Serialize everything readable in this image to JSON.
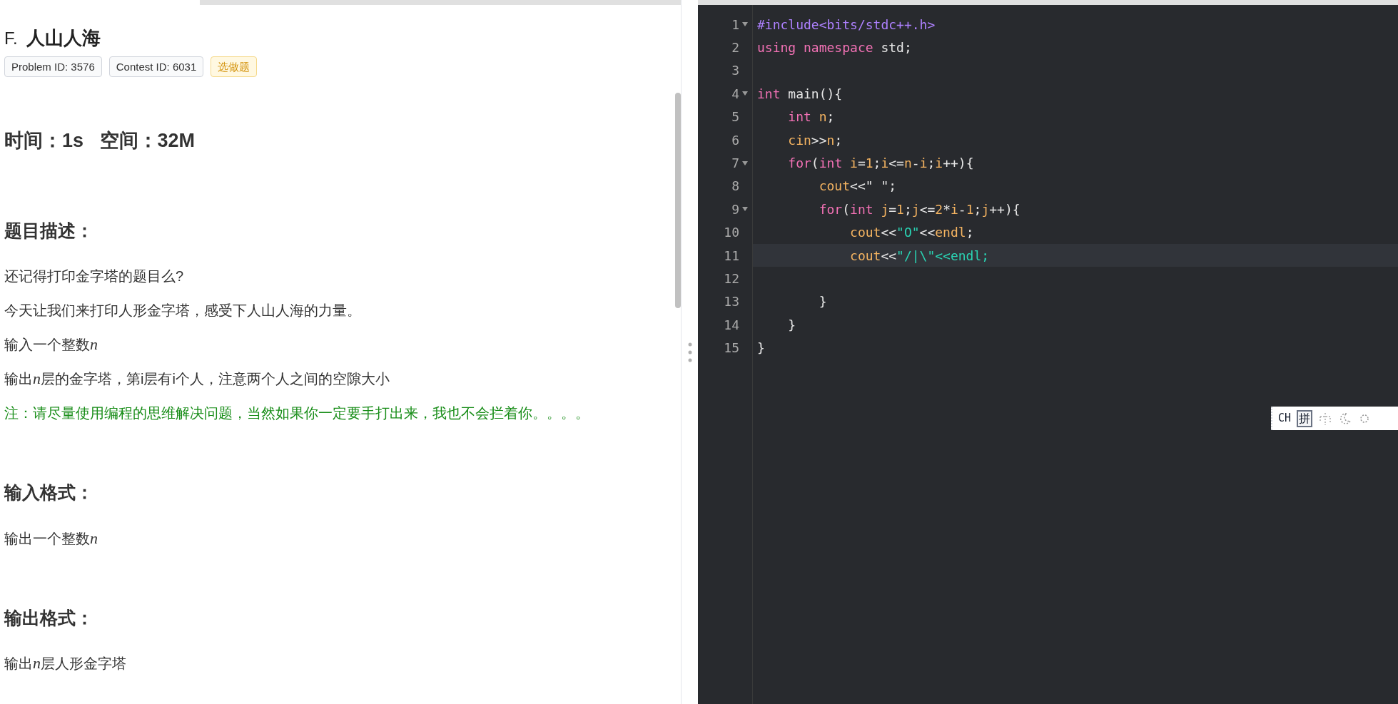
{
  "problem": {
    "letter": "F.",
    "title": "人山人海",
    "badges": [
      {
        "kind": "id",
        "text": "Problem ID: 3576"
      },
      {
        "kind": "id",
        "text": "Contest ID: 6031"
      },
      {
        "kind": "optional",
        "text": "选做题"
      }
    ],
    "limits": "时间：1s   空间：32M",
    "sections": [
      {
        "heading": "题目描述：",
        "paragraphs": [
          {
            "kind": "normal",
            "parts": [
              {
                "kind": "text",
                "text": "还记得打印金字塔的题目么?"
              }
            ]
          },
          {
            "kind": "normal",
            "parts": [
              {
                "kind": "text",
                "text": "今天让我们来打印人形金字塔，感受下人山人海的力量。"
              }
            ]
          },
          {
            "kind": "normal",
            "parts": [
              {
                "kind": "text",
                "text": "输入一个整数"
              },
              {
                "kind": "math",
                "text": "n"
              }
            ]
          },
          {
            "kind": "normal",
            "parts": [
              {
                "kind": "text",
                "text": "输出"
              },
              {
                "kind": "math",
                "text": "n"
              },
              {
                "kind": "text",
                "text": "层的金字塔，第i层有i个人，注意两个人之间的空隙大小"
              }
            ]
          },
          {
            "kind": "note",
            "parts": [
              {
                "kind": "text",
                "text": "注：请尽量使用编程的思维解决问题，当然如果你一定要手打出来，我也不会拦着你。。。。"
              }
            ]
          }
        ]
      },
      {
        "heading": "输入格式：",
        "paragraphs": [
          {
            "kind": "normal",
            "parts": [
              {
                "kind": "text",
                "text": "输出一个整数"
              },
              {
                "kind": "math",
                "text": "n"
              }
            ]
          }
        ]
      },
      {
        "heading": "输出格式：",
        "paragraphs": [
          {
            "kind": "normal",
            "parts": [
              {
                "kind": "text",
                "text": "输出"
              },
              {
                "kind": "math",
                "text": "n"
              },
              {
                "kind": "text",
                "text": "层人形金字塔"
              }
            ]
          }
        ]
      }
    ]
  },
  "editor": {
    "lines": [
      {
        "number": "1",
        "foldable": true,
        "active": false,
        "tokens": [
          {
            "kind": "preproc",
            "text": "#include<bits/stdc++.h>"
          }
        ]
      },
      {
        "number": "2",
        "foldable": false,
        "active": false,
        "tokens": [
          {
            "kind": "keyword",
            "text": "using"
          },
          {
            "kind": "keyword",
            "text": " namespace"
          },
          {
            "kind": "plain",
            "text": " std;"
          }
        ]
      },
      {
        "number": "3",
        "foldable": false,
        "active": false
      },
      {
        "number": "4",
        "foldable": true,
        "active": false,
        "tokens": [
          {
            "kind": "keyword",
            "text": "int"
          },
          {
            "kind": "plain",
            "text": " main(){"
          }
        ]
      },
      {
        "number": "5",
        "foldable": false,
        "active": false,
        "tokens": [
          {
            "kind": "keyword",
            "text": "    int"
          },
          {
            "kind": "variable",
            "text": " n"
          },
          {
            "kind": "plain",
            "text": ";"
          }
        ]
      },
      {
        "number": "6",
        "foldable": false,
        "active": false,
        "tokens": [
          {
            "kind": "variable",
            "text": "    cin"
          },
          {
            "kind": "plain",
            "text": ">>"
          },
          {
            "kind": "variable",
            "text": "n"
          },
          {
            "kind": "plain",
            "text": ";"
          }
        ]
      },
      {
        "number": "7",
        "foldable": true,
        "active": false,
        "tokens": [
          {
            "kind": "keyword",
            "text": "    for"
          },
          {
            "kind": "plain",
            "text": "("
          },
          {
            "kind": "keyword",
            "text": "int"
          },
          {
            "kind": "variable",
            "text": " i"
          },
          {
            "kind": "plain",
            "text": "="
          },
          {
            "kind": "variable",
            "text": "1"
          },
          {
            "kind": "plain",
            "text": ";"
          },
          {
            "kind": "variable",
            "text": "i"
          },
          {
            "kind": "plain",
            "text": "<="
          },
          {
            "kind": "variable",
            "text": "n"
          },
          {
            "kind": "plain",
            "text": "-"
          },
          {
            "kind": "variable",
            "text": "i"
          },
          {
            "kind": "plain",
            "text": ";"
          },
          {
            "kind": "variable",
            "text": "i"
          },
          {
            "kind": "plain",
            "text": "++){"
          }
        ]
      },
      {
        "number": "8",
        "foldable": false,
        "active": false,
        "tokens": [
          {
            "kind": "variable",
            "text": "        cout"
          },
          {
            "kind": "plain",
            "text": "<<\" \";"
          }
        ]
      },
      {
        "number": "9",
        "foldable": true,
        "active": false,
        "tokens": [
          {
            "kind": "keyword",
            "text": "        for"
          },
          {
            "kind": "plain",
            "text": "("
          },
          {
            "kind": "keyword",
            "text": "int"
          },
          {
            "kind": "variable",
            "text": " j"
          },
          {
            "kind": "plain",
            "text": "="
          },
          {
            "kind": "variable",
            "text": "1"
          },
          {
            "kind": "plain",
            "text": ";"
          },
          {
            "kind": "variable",
            "text": "j"
          },
          {
            "kind": "plain",
            "text": "<="
          },
          {
            "kind": "variable",
            "text": "2"
          },
          {
            "kind": "plain",
            "text": "*"
          },
          {
            "kind": "variable",
            "text": "i"
          },
          {
            "kind": "plain",
            "text": "-"
          },
          {
            "kind": "variable",
            "text": "1"
          },
          {
            "kind": "plain",
            "text": ";"
          },
          {
            "kind": "variable",
            "text": "j"
          },
          {
            "kind": "plain",
            "text": "++){"
          }
        ]
      },
      {
        "number": "10",
        "foldable": false,
        "active": false,
        "tokens": [
          {
            "kind": "variable",
            "text": "            cout"
          },
          {
            "kind": "plain",
            "text": "<<"
          },
          {
            "kind": "string",
            "text": "\"O\""
          },
          {
            "kind": "plain",
            "text": "<<"
          },
          {
            "kind": "variable",
            "text": "endl"
          },
          {
            "kind": "plain",
            "text": ";"
          }
        ]
      },
      {
        "number": "11",
        "foldable": false,
        "active": true,
        "tokens": [
          {
            "kind": "variable",
            "text": "            cout"
          },
          {
            "kind": "plain",
            "text": "<<"
          },
          {
            "kind": "string",
            "text": "\"/|\\\"<<endl;"
          }
        ]
      },
      {
        "number": "12",
        "foldable": false,
        "active": false
      },
      {
        "number": "13",
        "foldable": false,
        "active": false,
        "tokens": [
          {
            "kind": "plain",
            "text": "        }"
          }
        ]
      },
      {
        "number": "14",
        "foldable": false,
        "active": false,
        "tokens": [
          {
            "kind": "plain",
            "text": "    }"
          }
        ]
      },
      {
        "number": "15",
        "foldable": false,
        "active": false,
        "tokens": [
          {
            "kind": "plain",
            "text": "}"
          }
        ]
      }
    ]
  },
  "ime_toolbar": {
    "mode": "CH",
    "input": "拼"
  }
}
